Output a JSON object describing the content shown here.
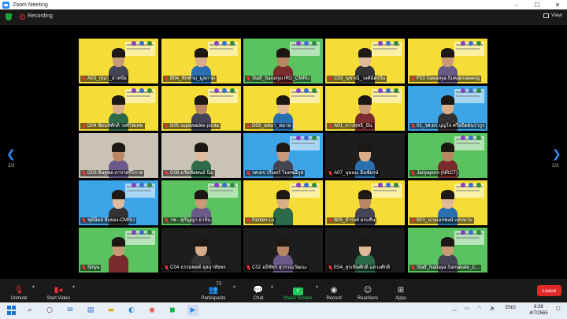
{
  "window": {
    "title": "Zoom Meeting",
    "controls": [
      "–",
      "☐",
      "✕"
    ]
  },
  "info": {
    "recording_label": "Recording",
    "view_label": "View"
  },
  "pager": {
    "left": "2/3",
    "right": "2/3"
  },
  "participants": [
    {
      "name": "A03_กุณา_ฮ่าลขีย",
      "bg": "yellow",
      "muted": true
    },
    {
      "name": "B04_ทักฬาม_มูลภาด",
      "bg": "yellow",
      "muted": true
    },
    {
      "name": "Staff_Sarunyu IRD_CMRU",
      "bg": "green",
      "muted": true
    },
    {
      "name": "C03_นุชาณี_วงศ์ฉัตรรัม",
      "bg": "yellow",
      "muted": true
    },
    {
      "name": "F03 Sawanya Suwannaweng",
      "bg": "yellow",
      "muted": true
    },
    {
      "name": "D04 ชัยนท์ศักดิ์ วงศ์ไพ่เทพ",
      "bg": "yellow",
      "muted": true
    },
    {
      "name": "D05 supawadee ponta",
      "bg": "yellow",
      "muted": true
    },
    {
      "name": "D03_นพมา_หมาย",
      "bg": "yellow",
      "muted": true
    },
    {
      "name": "A01_ภาวสุทธิ์_ปั้น",
      "bg": "yellow",
      "muted": true
    },
    {
      "name": "01_รศ.ดร.บุญใจ ศรีสถิตย์นรากูร",
      "bg": "blue",
      "muted": true
    },
    {
      "name": "G03 ดิษฐพล ภาราศรีไกาส",
      "bg": "room",
      "muted": true
    },
    {
      "name": "C06-ธวัชชัยพนธ์ นิ่ม",
      "bg": "room",
      "muted": true
    },
    {
      "name": "รศ.ดร.วรินทร์ ไบทชมีกุส",
      "bg": "blue",
      "muted": true
    },
    {
      "name": "A07_บุษณะ อินชัยรษ์",
      "bg": "dark",
      "muted": true
    },
    {
      "name": "Jariyaporn (NRCT)",
      "bg": "green",
      "muted": true
    },
    {
      "name": "ชุติษีตย์ สิงคอง-CMRU",
      "bg": "blue",
      "muted": true
    },
    {
      "name": "วช - สุกัญญา อาจ้น",
      "bg": "green",
      "muted": true
    },
    {
      "name": "Panten Lu",
      "bg": "yellow",
      "muted": true
    },
    {
      "name": "B05_ธำรงค์ ยระสั้น",
      "bg": "yellow",
      "muted": true
    },
    {
      "name": "B01_นายเอกพงษ์ แสงนาม",
      "bg": "yellow",
      "muted": true
    },
    {
      "name": "Siriya",
      "bg": "green",
      "muted": true
    },
    {
      "name": "C04 ธรรมพลต์ จุลฤาทัยพร",
      "bg": "dark",
      "muted": true
    },
    {
      "name": "C02 อธิพัชร์ สุวรรณวัฒนะ",
      "bg": "dark",
      "muted": true
    },
    {
      "name": "E04_สุรเชิษศักดิ์ แสวงศักดิ์",
      "bg": "dark",
      "muted": true
    },
    {
      "name": "Staff_Nattaya Samakate_C...",
      "bg": "green",
      "muted": true
    }
  ],
  "toolbar": {
    "unmute": "Unmute",
    "start_video": "Start Video",
    "participants": "Participants",
    "participants_count": "72",
    "chat": "Chat",
    "share_screen": "Share Screen",
    "record": "Record",
    "reactions": "Reactions",
    "apps": "Apps",
    "leave": "Leave"
  },
  "taskbar": {
    "lang": "ENG",
    "time": "8:38",
    "date": "4/7/2565"
  },
  "colors": {
    "accent": "#2d8cff",
    "share": "#23c65b",
    "leave": "#e02828"
  }
}
